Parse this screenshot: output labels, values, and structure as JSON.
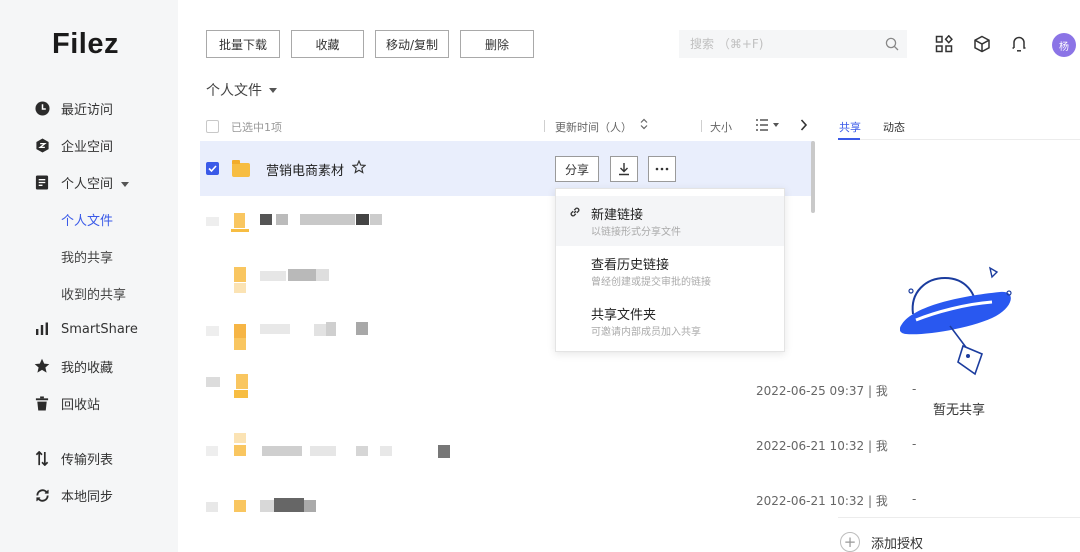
{
  "app": {
    "logo": "Filez",
    "brand_color": "#3a5ae8",
    "avatar_color": "#8b74e6"
  },
  "sidebar": {
    "items": [
      {
        "label": "最近访问",
        "icon": "clock-icon"
      },
      {
        "label": "企业空间",
        "icon": "enterprise-icon"
      },
      {
        "label": "个人空间",
        "icon": "document-icon",
        "expanded": true
      },
      {
        "label": "个人文件",
        "sub": true,
        "active": true
      },
      {
        "label": "我的共享",
        "sub": true
      },
      {
        "label": "收到的共享",
        "sub": true
      },
      {
        "label": "SmartShare",
        "icon": "bar-chart-icon"
      },
      {
        "label": "我的收藏",
        "icon": "star-icon"
      },
      {
        "label": "回收站",
        "icon": "trash-icon"
      },
      {
        "label": "传输列表",
        "icon": "transfer-icon"
      },
      {
        "label": "本地同步",
        "icon": "sync-icon"
      }
    ]
  },
  "toolbar": {
    "batch_download": "批量下载",
    "favorite": "收藏",
    "move_copy": "移动/复制",
    "delete": "删除"
  },
  "search": {
    "placeholder": "搜索 （⌘+F)"
  },
  "header_icons": [
    "apps-icon",
    "box-icon",
    "bell-icon"
  ],
  "avatar": {
    "text": "杨"
  },
  "breadcrumb": {
    "label": "个人文件"
  },
  "table": {
    "selected_count": "已选中1项",
    "col_time": "更新时间（人）",
    "col_size": "大小",
    "rows": [
      {
        "name": "营销电商素材",
        "selected": true,
        "time": "",
        "size": ""
      },
      {
        "name": "",
        "time": "",
        "size": ""
      },
      {
        "name": "",
        "time": "",
        "size": ""
      },
      {
        "name": "",
        "time": "",
        "size": ""
      },
      {
        "name": "",
        "time": "2022-06-25 09:37 | 我",
        "size": "-"
      },
      {
        "name": "",
        "time": "2022-06-21 10:32 | 我",
        "size": "-"
      },
      {
        "name": "",
        "time": "2022-06-21 10:32 | 我",
        "size": "-"
      }
    ]
  },
  "row_actions": {
    "share": "分享"
  },
  "share_menu": [
    {
      "title": "新建链接",
      "desc": "以链接形式分享文件",
      "icon": "link-icon"
    },
    {
      "title": "查看历史链接",
      "desc": "曾经创建或提交审批的链接"
    },
    {
      "title": "共享文件夹",
      "desc": "可邀请内部成员加入共享"
    }
  ],
  "right_panel": {
    "tab_share": "共享",
    "tab_activity": "动态",
    "empty_text": "暂无共享",
    "add_auth": "添加授权"
  }
}
